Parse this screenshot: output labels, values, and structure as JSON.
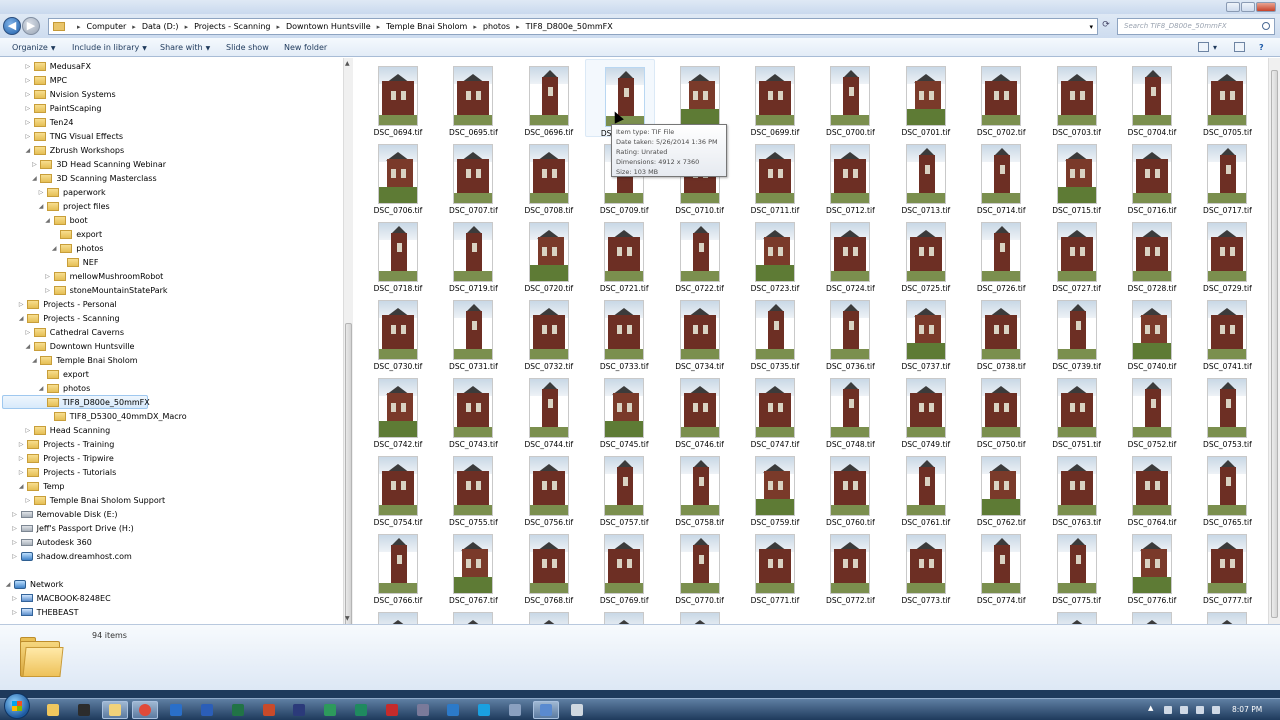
{
  "address": {
    "crumbs": [
      "Computer",
      "Data (D:)",
      "Projects - Scanning",
      "Downtown Huntsville",
      "Temple Bnai Sholom",
      "photos",
      "TIF8_D800e_50mmFX"
    ],
    "search_placeholder": "Search TIF8_D800e_50mmFX"
  },
  "toolbar": {
    "organize": "Organize",
    "include": "Include in library",
    "share": "Share with",
    "slideshow": "Slide show",
    "newfolder": "New folder"
  },
  "tree": [
    {
      "label": "MedusaFX",
      "level": 3,
      "tw": "▷"
    },
    {
      "label": "MPC",
      "level": 3,
      "tw": "▷"
    },
    {
      "label": "Nvision Systems",
      "level": 3,
      "tw": "▷"
    },
    {
      "label": "PaintScaping",
      "level": 3,
      "tw": "▷"
    },
    {
      "label": "Ten24",
      "level": 3,
      "tw": "▷"
    },
    {
      "label": "TNG Visual Effects",
      "level": 3,
      "tw": "▷"
    },
    {
      "label": "Zbrush Workshops",
      "level": 3,
      "tw": "◢"
    },
    {
      "label": "3D Head Scanning Webinar",
      "level": 4,
      "tw": "▷"
    },
    {
      "label": "3D Scanning Masterclass",
      "level": 4,
      "tw": "◢"
    },
    {
      "label": "paperwork",
      "level": 5,
      "tw": "▷"
    },
    {
      "label": "project files",
      "level": 5,
      "tw": "◢"
    },
    {
      "label": "boot",
      "level": 6,
      "tw": "◢"
    },
    {
      "label": "export",
      "level": 7,
      "tw": ""
    },
    {
      "label": "photos",
      "level": 7,
      "tw": "◢"
    },
    {
      "label": "NEF",
      "level": 8,
      "tw": ""
    },
    {
      "label": "mellowMushroomRobot",
      "level": 6,
      "tw": "▷"
    },
    {
      "label": "stoneMountainStatePark",
      "level": 6,
      "tw": "▷"
    },
    {
      "label": "Projects - Personal",
      "level": 2,
      "tw": "▷"
    },
    {
      "label": "Projects - Scanning",
      "level": 2,
      "tw": "◢"
    },
    {
      "label": "Cathedral Caverns",
      "level": 3,
      "tw": "▷"
    },
    {
      "label": "Downtown Huntsville",
      "level": 3,
      "tw": "◢"
    },
    {
      "label": "Temple Bnai Sholom",
      "level": 4,
      "tw": "◢"
    },
    {
      "label": "export",
      "level": 5,
      "tw": ""
    },
    {
      "label": "photos",
      "level": 5,
      "tw": "◢"
    },
    {
      "label": "TIF8_D800e_50mmFX",
      "level": 6,
      "tw": "",
      "sel": true
    },
    {
      "label": "TIF8_D5300_40mmDX_Macro",
      "level": 6,
      "tw": ""
    },
    {
      "label": "Head Scanning",
      "level": 3,
      "tw": "▷"
    },
    {
      "label": "Projects - Training",
      "level": 2,
      "tw": "▷"
    },
    {
      "label": "Projects - Tripwire",
      "level": 2,
      "tw": "▷"
    },
    {
      "label": "Projects - Tutorials",
      "level": 2,
      "tw": "▷"
    },
    {
      "label": "Temp",
      "level": 2,
      "tw": "◢"
    },
    {
      "label": "Temple Bnai Sholom Support",
      "level": 3,
      "tw": "▷"
    },
    {
      "label": "Removable Disk (E:)",
      "level": 1,
      "tw": "▷",
      "icon": "drive"
    },
    {
      "label": "Jeff's Passport Drive (H:)",
      "level": 1,
      "tw": "▷",
      "icon": "drive"
    },
    {
      "label": "Autodesk 360",
      "level": 1,
      "tw": "▷",
      "icon": "drive"
    },
    {
      "label": "shadow.dreamhost.com",
      "level": 1,
      "tw": "▷",
      "icon": "net"
    },
    {
      "label": "",
      "level": 0,
      "tw": ""
    },
    {
      "label": "Network",
      "level": 0,
      "tw": "◢",
      "icon": "net"
    },
    {
      "label": "MACBOOK-8248EC",
      "level": 1,
      "tw": "▷",
      "icon": "pc"
    },
    {
      "label": "THEBEAST",
      "level": 1,
      "tw": "▷",
      "icon": "pc"
    }
  ],
  "files": [
    "DSC_0694.tif",
    "DSC_0695.tif",
    "DSC_0696.tif",
    "DSC_0697.tif",
    "DSC_0698.tif",
    "DSC_0699.tif",
    "DSC_0700.tif",
    "DSC_0701.tif",
    "DSC_0702.tif",
    "DSC_0703.tif",
    "DSC_0704.tif",
    "DSC_0705.tif",
    "DSC_0706.tif",
    "DSC_0707.tif",
    "DSC_0708.tif",
    "DSC_0709.tif",
    "DSC_0710.tif",
    "DSC_0711.tif",
    "DSC_0712.tif",
    "DSC_0713.tif",
    "DSC_0714.tif",
    "DSC_0715.tif",
    "DSC_0716.tif",
    "DSC_0717.tif",
    "DSC_0718.tif",
    "DSC_0719.tif",
    "DSC_0720.tif",
    "DSC_0721.tif",
    "DSC_0722.tif",
    "DSC_0723.tif",
    "DSC_0724.tif",
    "DSC_0725.tif",
    "DSC_0726.tif",
    "DSC_0727.tif",
    "DSC_0728.tif",
    "DSC_0729.tif",
    "DSC_0730.tif",
    "DSC_0731.tif",
    "DSC_0732.tif",
    "DSC_0733.tif",
    "DSC_0734.tif",
    "DSC_0735.tif",
    "DSC_0736.tif",
    "DSC_0737.tif",
    "DSC_0738.tif",
    "DSC_0739.tif",
    "DSC_0740.tif",
    "DSC_0741.tif",
    "DSC_0742.tif",
    "DSC_0743.tif",
    "DSC_0744.tif",
    "DSC_0745.tif",
    "DSC_0746.tif",
    "DSC_0747.tif",
    "DSC_0748.tif",
    "DSC_0749.tif",
    "DSC_0750.tif",
    "DSC_0751.tif",
    "DSC_0752.tif",
    "DSC_0753.tif",
    "DSC_0754.tif",
    "DSC_0755.tif",
    "DSC_0756.tif",
    "DSC_0757.tif",
    "DSC_0758.tif",
    "DSC_0759.tif",
    "DSC_0760.tif",
    "DSC_0761.tif",
    "DSC_0762.tif",
    "DSC_0763.tif",
    "DSC_0764.tif",
    "DSC_0765.tif",
    "DSC_0766.tif",
    "DSC_0767.tif",
    "DSC_0768.tif",
    "DSC_0769.tif",
    "DSC_0770.tif",
    "DSC_0771.tif",
    "DSC_0772.tif",
    "DSC_0773.tif",
    "DSC_0774.tif",
    "DSC_0775.tif",
    "DSC_0776.tif",
    "DSC_0777.tif"
  ],
  "tooltip": {
    "type": "Item type: TIF File",
    "date": "Date taken: 5/26/2014 1:36 PM",
    "rating": "Rating: Unrated",
    "dims": "Dimensions: 4912 x 7360",
    "size": "Size: 103 MB"
  },
  "details": {
    "count": "94 items"
  },
  "taskbar": {
    "clock": "8:07 PM",
    "apps": [
      "explorer",
      "media",
      "explorer-folder",
      "chrome",
      "outlook",
      "word",
      "excel",
      "powerpoint",
      "photoshop",
      "app-green",
      "app-green2",
      "acrobat",
      "app-x",
      "app-blue",
      "skype",
      "app-grid",
      "app-mesh",
      "app-win"
    ]
  }
}
